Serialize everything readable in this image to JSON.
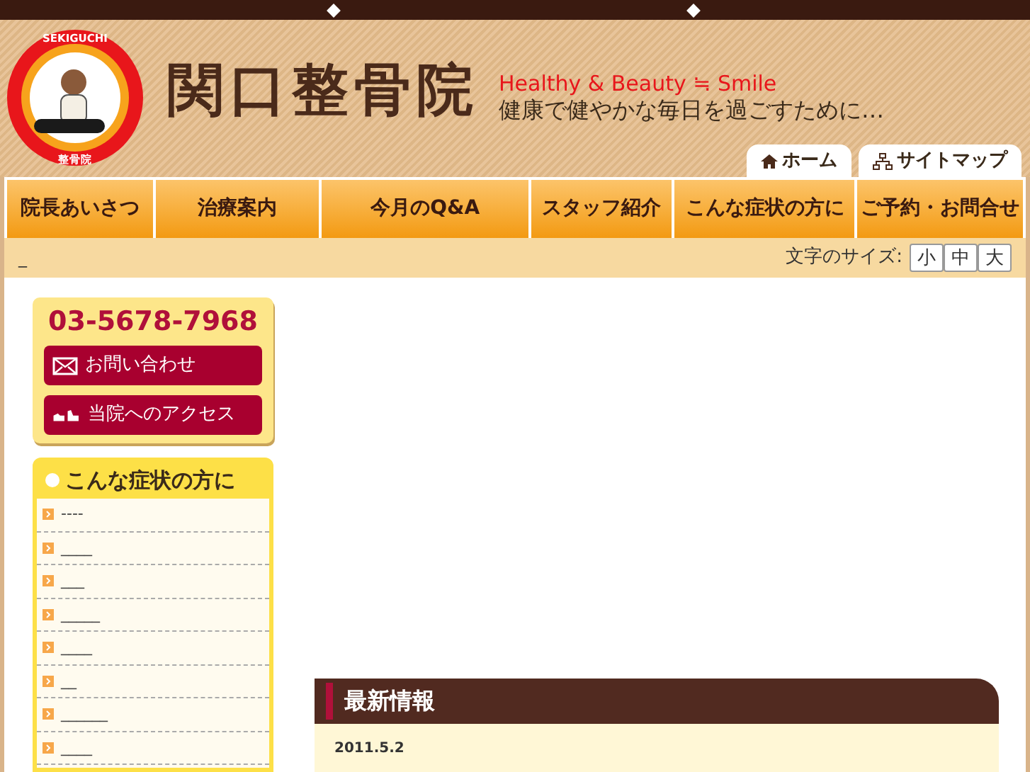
{
  "logo": {
    "top_text": "SEKIGUCHI",
    "bottom_text": "整骨院"
  },
  "site_title": "関口整骨院",
  "tagline": "Healthy & Beauty ≒ Smile",
  "subtitle": "健康で健やかな毎日を過ごすために…",
  "header_tabs": [
    {
      "label": "ホーム",
      "kind": "home"
    },
    {
      "label": "サイトマップ",
      "kind": "sitemap"
    }
  ],
  "nav": [
    "院長あいさつ",
    "治療案内",
    "今月のQ&A",
    "スタッフ紹介",
    "こんな症状の方に",
    "ご予約・お問合せ"
  ],
  "breadcrumb": "_",
  "font_size": {
    "label": "文字のサイズ:",
    "options": [
      {
        "label": "小",
        "selected": false
      },
      {
        "label": "中",
        "selected": false
      },
      {
        "label": "大",
        "selected": false
      }
    ]
  },
  "contact": {
    "phone": "03-5678-7968",
    "buttons": [
      {
        "label": "お問い合わせ",
        "kind": "mail"
      },
      {
        "label": "当院へのアクセス",
        "kind": "access"
      }
    ]
  },
  "symptoms": {
    "title": "こんな症状の方に",
    "items": [
      "----",
      "____",
      "___",
      "_____",
      "____",
      "__",
      "______",
      "____"
    ]
  },
  "news": {
    "title": "最新情報",
    "date": "2011.5.2"
  }
}
